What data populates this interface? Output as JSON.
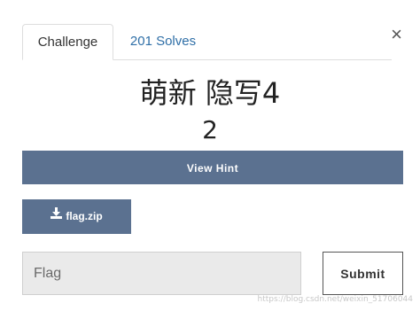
{
  "tabs": [
    {
      "label": "Challenge"
    },
    {
      "label": "201 Solves"
    }
  ],
  "close_symbol": "×",
  "challenge": {
    "title": "萌新 隐写4",
    "points": "2"
  },
  "hint_button": {
    "label": "View Hint"
  },
  "file_button": {
    "label": "flag.zip",
    "icon": "download-icon"
  },
  "flag_input": {
    "placeholder": "Flag",
    "value": ""
  },
  "submit_button": {
    "label": "Submit"
  },
  "watermark": "https://blog.csdn.net/weixin_51706044",
  "colors": {
    "button_bg": "#5b7190",
    "tab_link": "#2f6fa7",
    "input_bg": "#eaeaea"
  }
}
